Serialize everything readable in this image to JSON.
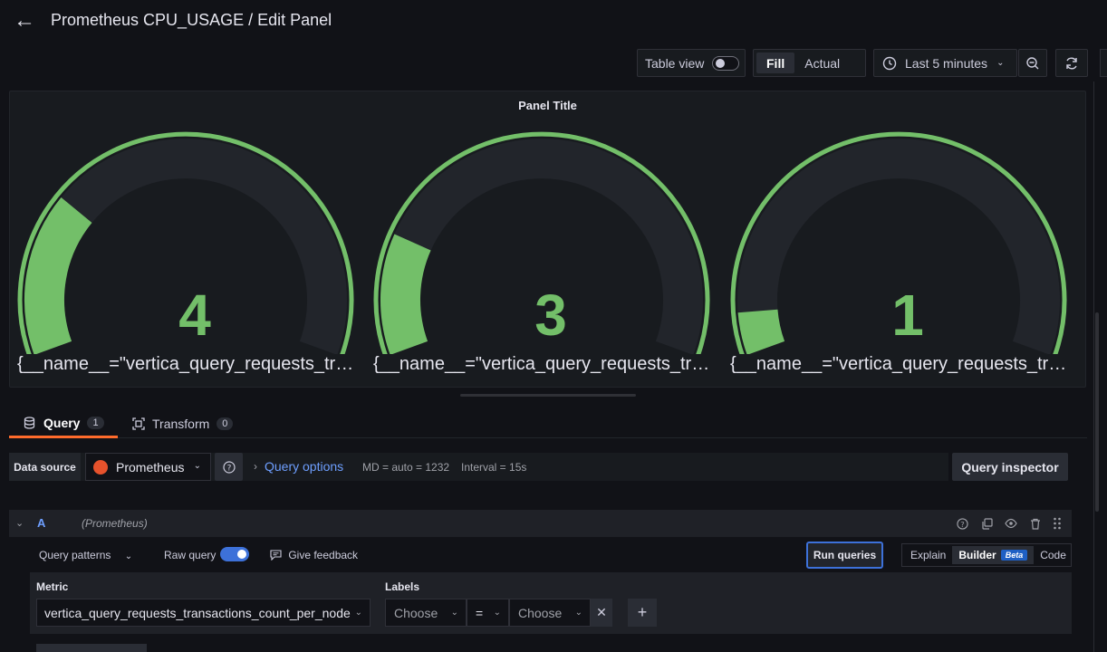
{
  "header": {
    "title": "Prometheus CPU_USAGE / Edit Panel"
  },
  "toolbar": {
    "table_view_label": "Table view",
    "fill_label": "Fill",
    "actual_label": "Actual",
    "time_range_label": "Last 5 minutes"
  },
  "panel": {
    "title": "Panel Title",
    "gauges": [
      {
        "value": "4",
        "fraction": 0.27,
        "label": "{__name__=\"vertica_query_requests_transactions_count_per_node\"}"
      },
      {
        "value": "3",
        "fraction": 0.2,
        "label": "{__name__=\"vertica_query_requests_transactions_count_per_node\"}"
      },
      {
        "value": "1",
        "fraction": 0.07,
        "label": "{__name__=\"vertica_query_requests_transactions_count_per_node\"}"
      }
    ],
    "color": "#73bf69"
  },
  "tabs": [
    {
      "label": "Query",
      "count": "1"
    },
    {
      "label": "Transform",
      "count": "0"
    }
  ],
  "query_bar": {
    "data_source_label": "Data source",
    "data_source_value": "Prometheus",
    "query_options_label": "Query options",
    "md_text": "MD = auto = 1232",
    "interval_text": "Interval = 15s",
    "inspector_label": "Query inspector"
  },
  "query_row": {
    "ref_id": "A",
    "datasource": "(Prometheus)"
  },
  "query_options": {
    "patterns_label": "Query patterns",
    "raw_query_label": "Raw query",
    "feedback_label": "Give feedback",
    "run_label": "Run queries",
    "modes": [
      "Explain",
      "Builder",
      "Code"
    ],
    "beta_label": "Beta"
  },
  "builder": {
    "metric_label": "Metric",
    "metric_value": "vertica_query_requests_transactions_count_per_node",
    "labels_label": "Labels",
    "label_key_placeholder": "Choose",
    "operator": "=",
    "label_value_placeholder": "Choose"
  }
}
